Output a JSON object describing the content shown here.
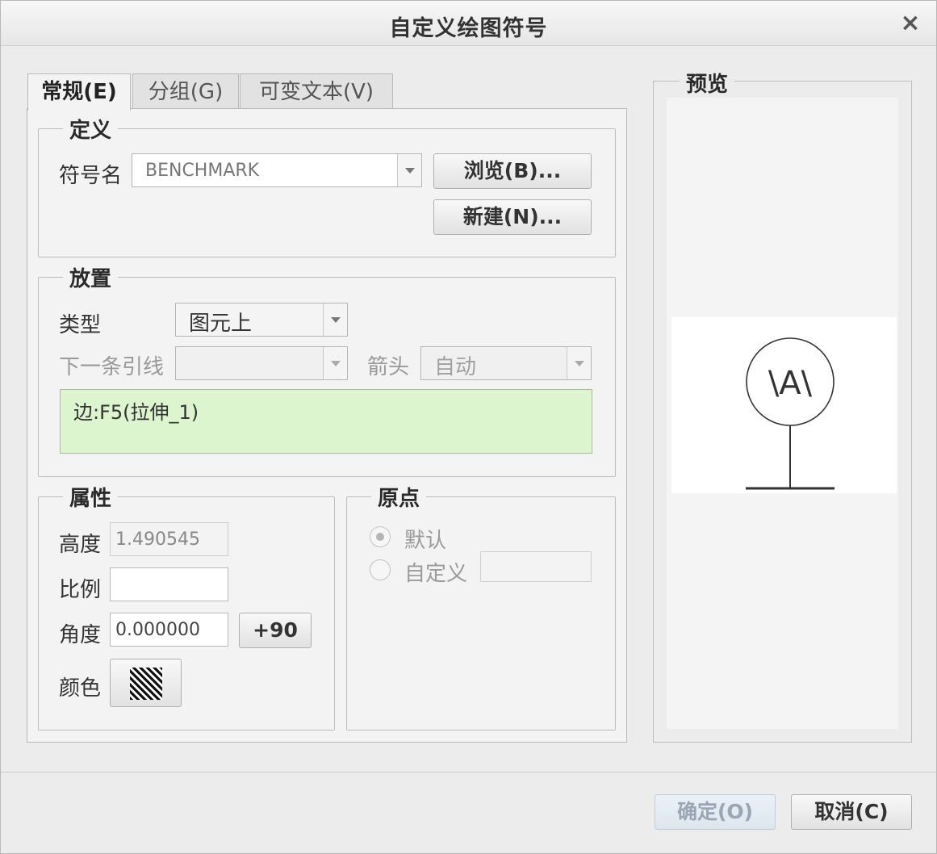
{
  "dialog": {
    "title": "自定义绘图符号",
    "close": "×"
  },
  "tabs": [
    {
      "label": "常规(E)",
      "active": true
    },
    {
      "label": "分组(G)",
      "active": false
    },
    {
      "label": "可变文本(V)",
      "active": false
    }
  ],
  "definition": {
    "title": "定义",
    "symbol_name_label": "符号名",
    "symbol_name_value": "BENCHMARK",
    "browse_button": "浏览(B)...",
    "new_button": "新建(N)..."
  },
  "placement": {
    "title": "放置",
    "type_label": "类型",
    "type_value": "图元上",
    "next_leader_label": "下一条引线",
    "next_leader_value": "",
    "arrow_label": "箭头",
    "arrow_value": "自动",
    "reference": "边:F5(拉伸_1)"
  },
  "properties": {
    "title": "属性",
    "height_label": "高度",
    "height_value": "1.490545",
    "scale_label": "比例",
    "scale_value": "",
    "angle_label": "角度",
    "angle_value": "0.000000",
    "rotate_button": "+90",
    "color_label": "颜色",
    "color_swatch_icon": "hatch-pattern-icon"
  },
  "origin": {
    "title": "原点",
    "default_label": "默认",
    "default_checked": true,
    "custom_label": "自定义",
    "custom_checked": false,
    "custom_value": ""
  },
  "preview": {
    "title": "预览",
    "symbol_text": "\\A\\"
  },
  "footer": {
    "ok_button": "确定(O)",
    "cancel_button": "取消(C)"
  },
  "colors": {
    "reference_bg": "#dcf5cf",
    "dialog_bg": "#ececec",
    "disabled_button_text": "#9aa6b4"
  }
}
